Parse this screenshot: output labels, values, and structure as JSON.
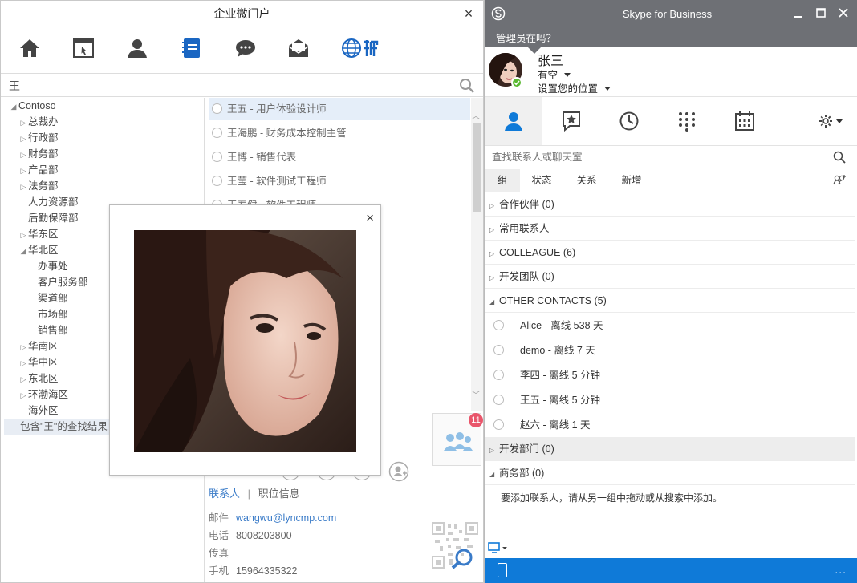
{
  "left": {
    "title": "企业微门户",
    "search_value": "王",
    "tree": [
      {
        "label": "Contoso",
        "indent": 0,
        "arrow": "open"
      },
      {
        "label": "总裁办",
        "indent": 1,
        "arrow": "closed"
      },
      {
        "label": "行政部",
        "indent": 1,
        "arrow": "closed"
      },
      {
        "label": "财务部",
        "indent": 1,
        "arrow": "closed"
      },
      {
        "label": "产品部",
        "indent": 1,
        "arrow": "closed"
      },
      {
        "label": "法务部",
        "indent": 1,
        "arrow": "closed"
      },
      {
        "label": "人力资源部",
        "indent": 1,
        "arrow": "none"
      },
      {
        "label": "后勤保障部",
        "indent": 1,
        "arrow": "none"
      },
      {
        "label": "华东区",
        "indent": 1,
        "arrow": "closed"
      },
      {
        "label": "华北区",
        "indent": 1,
        "arrow": "open"
      },
      {
        "label": "办事处",
        "indent": 2,
        "arrow": "none"
      },
      {
        "label": "客户服务部",
        "indent": 2,
        "arrow": "none"
      },
      {
        "label": "渠道部",
        "indent": 2,
        "arrow": "none"
      },
      {
        "label": "市场部",
        "indent": 2,
        "arrow": "none"
      },
      {
        "label": "销售部",
        "indent": 2,
        "arrow": "none"
      },
      {
        "label": "华南区",
        "indent": 1,
        "arrow": "closed"
      },
      {
        "label": "华中区",
        "indent": 1,
        "arrow": "closed"
      },
      {
        "label": "东北区",
        "indent": 1,
        "arrow": "closed"
      },
      {
        "label": "环渤海区",
        "indent": 1,
        "arrow": "closed"
      },
      {
        "label": "海外区",
        "indent": 1,
        "arrow": "none"
      }
    ],
    "search_result": "包含\"王\"的查找结果",
    "people": [
      {
        "label": "王五 - 用户体验设计师",
        "selected": true
      },
      {
        "label": "王海鹏 - 财务成本控制主管",
        "selected": false
      },
      {
        "label": "王博 - 销售代表",
        "selected": false
      },
      {
        "label": "王莹 - 软件测试工程师",
        "selected": false
      },
      {
        "label": "王泰健 - 软件工程师",
        "selected": false
      }
    ],
    "badge": "11",
    "detail_tabs": {
      "contact": "联系人",
      "sep": "|",
      "job": "职位信息"
    },
    "details": [
      {
        "key": "邮件",
        "value": "wangwu@lyncmp.com",
        "link": true
      },
      {
        "key": "电话",
        "value": "8008203800",
        "link": false
      },
      {
        "key": "传真",
        "value": "",
        "link": false
      },
      {
        "key": "手机",
        "value": "15964335322",
        "link": false
      }
    ],
    "close_glyph": "×"
  },
  "popup": {
    "close_glyph": "×"
  },
  "skype": {
    "app_title": "Skype for Business",
    "note_prompt": "管理员在吗？",
    "me": {
      "name": "张三",
      "status": "有空",
      "location": "设置您的位置"
    },
    "search_placeholder": "查找联系人或聊天室",
    "subtabs": [
      "组",
      "状态",
      "关系",
      "新增"
    ],
    "groups_top": [
      {
        "label": "合作伙伴 (0)",
        "open": false
      },
      {
        "label": "常用联系人",
        "open": false
      },
      {
        "label": "COLLEAGUE (6)",
        "open": false
      },
      {
        "label": "开发团队 (0)",
        "open": false
      },
      {
        "label": "OTHER CONTACTS (5)",
        "open": true
      }
    ],
    "contacts": [
      {
        "name": "Alice",
        "status": "离线 538 天"
      },
      {
        "name": "demo",
        "status": "离线 7 天"
      },
      {
        "name": "李四",
        "status": "离线 5 分钟"
      },
      {
        "name": "王五",
        "status": "离线 5 分钟"
      },
      {
        "name": "赵六",
        "status": "离线 1 天"
      }
    ],
    "groups_bottom": [
      {
        "label": "开发部门 (0)",
        "open": false,
        "highlight": true
      },
      {
        "label": "商务部 (0)",
        "open": true,
        "highlight": false
      }
    ],
    "empty_hint": "要添加联系人，请从另一组中拖动或从搜索中添加。",
    "more_glyph": "..."
  },
  "colors": {
    "skype_title_bar": "#6e7075",
    "skype_status_bar": "#0f7ad8",
    "accent": "#3a7bc8",
    "presence_available": "#5ab931",
    "badge": "#e9566b"
  }
}
